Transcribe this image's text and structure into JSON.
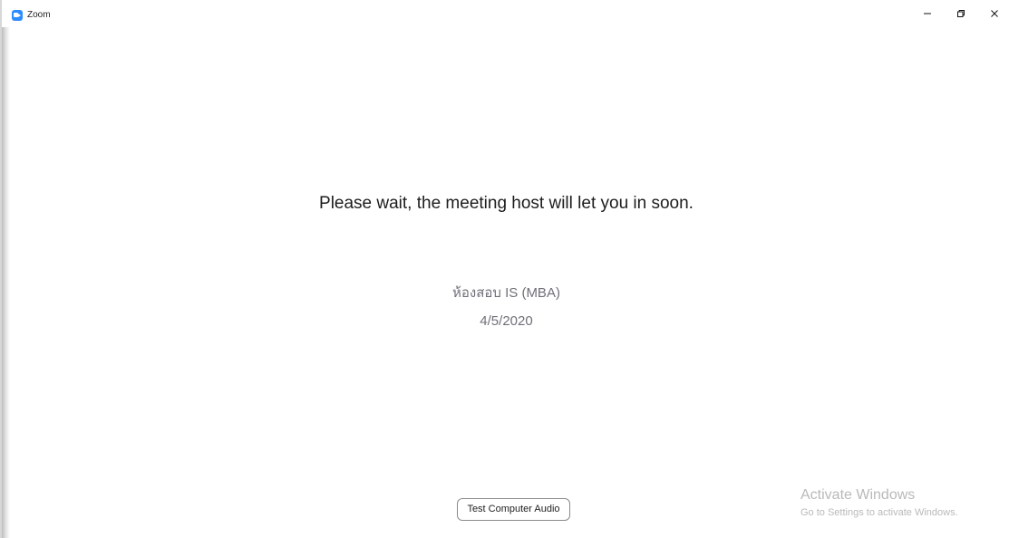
{
  "window": {
    "title": "Zoom",
    "controls": {
      "minimize": "minimize",
      "restore": "restore",
      "close": "close"
    }
  },
  "main": {
    "message": "Please wait, the meeting host will let you in soon.",
    "meeting_name": "ห้องสอบ IS (MBA)",
    "meeting_date": "4/5/2020"
  },
  "footer": {
    "test_audio_label": "Test Computer Audio"
  },
  "watermark": {
    "title": "Activate Windows",
    "subtitle": "Go to Settings to activate Windows."
  },
  "icons": {
    "app": "zoom-video-icon",
    "minimize": "minimize-icon",
    "restore": "restore-icon",
    "close": "close-icon"
  },
  "colors": {
    "zoom_blue": "#2d8cff",
    "message_text": "#1d1d1d",
    "meeting_text": "#6f6f78",
    "watermark_text": "#b9b9b9"
  }
}
